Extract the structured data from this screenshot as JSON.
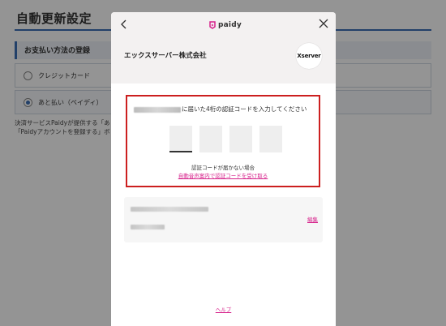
{
  "background": {
    "title": "自動更新設定",
    "section_heading": "お支払い方法の登録",
    "options": [
      {
        "label": "クレジットカード",
        "selected": false
      },
      {
        "label": "あと払い（ペイディ）",
        "selected": true
      }
    ],
    "note_line1": "決済サービスPaidyが提供する「あ",
    "note_line2": "「Paidyアカウントを登録する」ボ"
  },
  "modal": {
    "brand": "paidy",
    "merchant_name": "エックスサーバー株式会社",
    "merchant_logo_text": "Xserver",
    "verification": {
      "prompt": "に届いた4桁の認証コードを入力してください",
      "digits": [
        "",
        "",
        "",
        ""
      ],
      "no_code_text": "認証コードが届かない場合",
      "voice_link": "自動音声案内で認証コードを受け取る"
    },
    "account": {
      "edit_label": "編集"
    },
    "help_label": "ヘルプ"
  },
  "colors": {
    "accent_pink": "#d6208a",
    "highlight_red": "#cc1f1f",
    "brand_blue": "#3b6fb5"
  },
  "icons": {
    "back": "chevron-left-icon",
    "close": "close-icon",
    "brand": "paidy-logo-icon"
  }
}
